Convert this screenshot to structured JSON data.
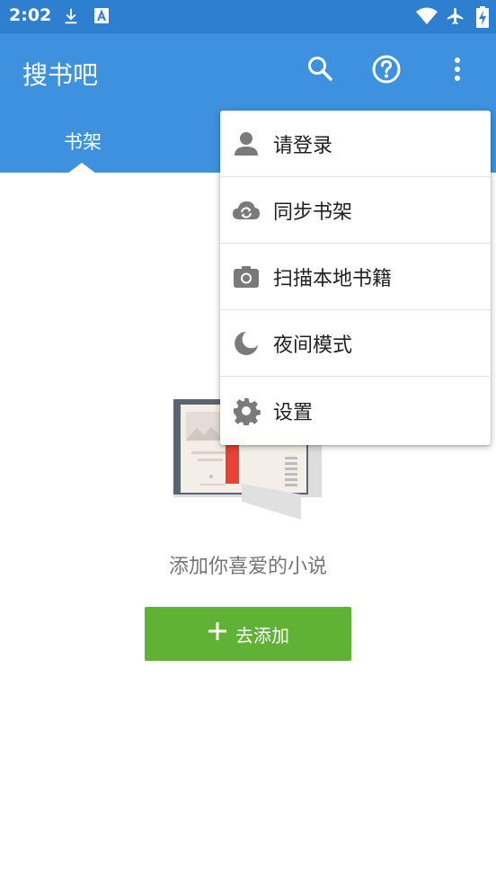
{
  "status_bar": {
    "time": "2:02",
    "icons": [
      "download-icon",
      "a-icon",
      "wifi-icon",
      "airplane-icon",
      "battery-charging-icon"
    ]
  },
  "app_bar": {
    "title": "搜书吧",
    "actions": [
      "search-icon",
      "help-icon",
      "more-vert-icon"
    ],
    "tabs": [
      {
        "label": "书架",
        "selected": true
      }
    ]
  },
  "menu": {
    "items": [
      {
        "label": "请登录",
        "icon": "person-icon"
      },
      {
        "label": "同步书架",
        "icon": "cloud-sync-icon"
      },
      {
        "label": "扫描本地书籍",
        "icon": "camera-icon"
      },
      {
        "label": "夜间模式",
        "icon": "moon-icon"
      },
      {
        "label": "设置",
        "icon": "gear-icon"
      }
    ]
  },
  "empty_state": {
    "message": "添加你喜爱的小说",
    "button_label": "去添加",
    "button_icon": "plus-icon"
  },
  "colors": {
    "status_bar": "#2f7fd1",
    "app_bar": "#3d91df",
    "button": "#5fb234",
    "icon_gray": "#7a7a7a"
  }
}
